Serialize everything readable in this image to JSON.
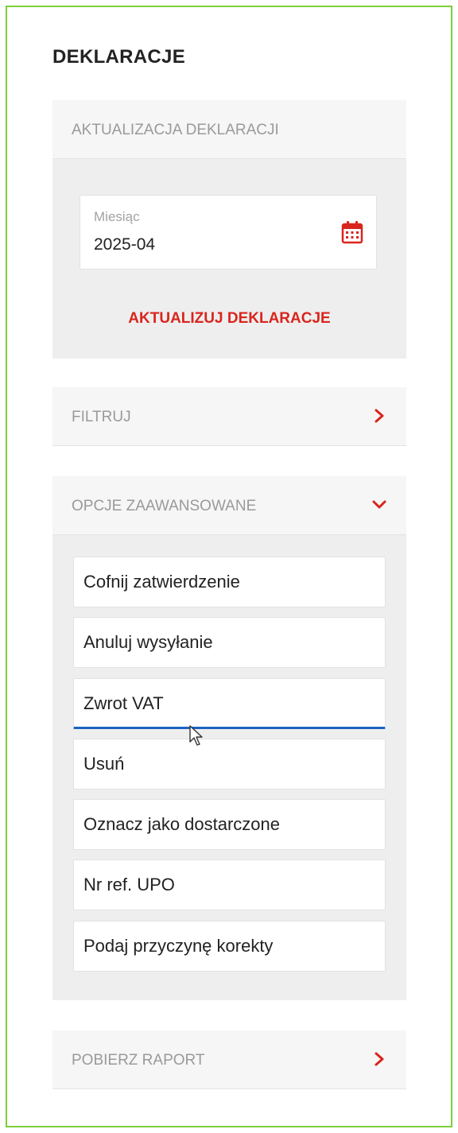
{
  "page": {
    "title": "DEKLARACJE"
  },
  "update_panel": {
    "title": "AKTUALIZACJA DEKLARACJI",
    "month_label": "Miesiąc",
    "month_value": "2025-04",
    "month_icon": "calendar-icon",
    "action_label": "AKTUALIZUJ DEKLARACJE"
  },
  "filter_panel": {
    "title": "FILTRUJ",
    "icon": "chevron-right-icon"
  },
  "advanced_panel": {
    "title": "OPCJE ZAAWANSOWANE",
    "icon": "chevron-down-icon",
    "options": [
      {
        "label": "Cofnij zatwierdzenie"
      },
      {
        "label": "Anuluj wysyłanie"
      },
      {
        "label": "Zwrot VAT"
      },
      {
        "label": "Usuń"
      },
      {
        "label": "Oznacz jako dostarczone"
      },
      {
        "label": "Nr ref. UPO"
      },
      {
        "label": "Podaj przyczynę korekty"
      }
    ]
  },
  "report_panel": {
    "title": "POBIERZ RAPORT",
    "icon": "chevron-right-icon"
  },
  "colors": {
    "accent": "#d9251d",
    "focus": "#1a63c2",
    "frame": "#7ccf3b"
  }
}
